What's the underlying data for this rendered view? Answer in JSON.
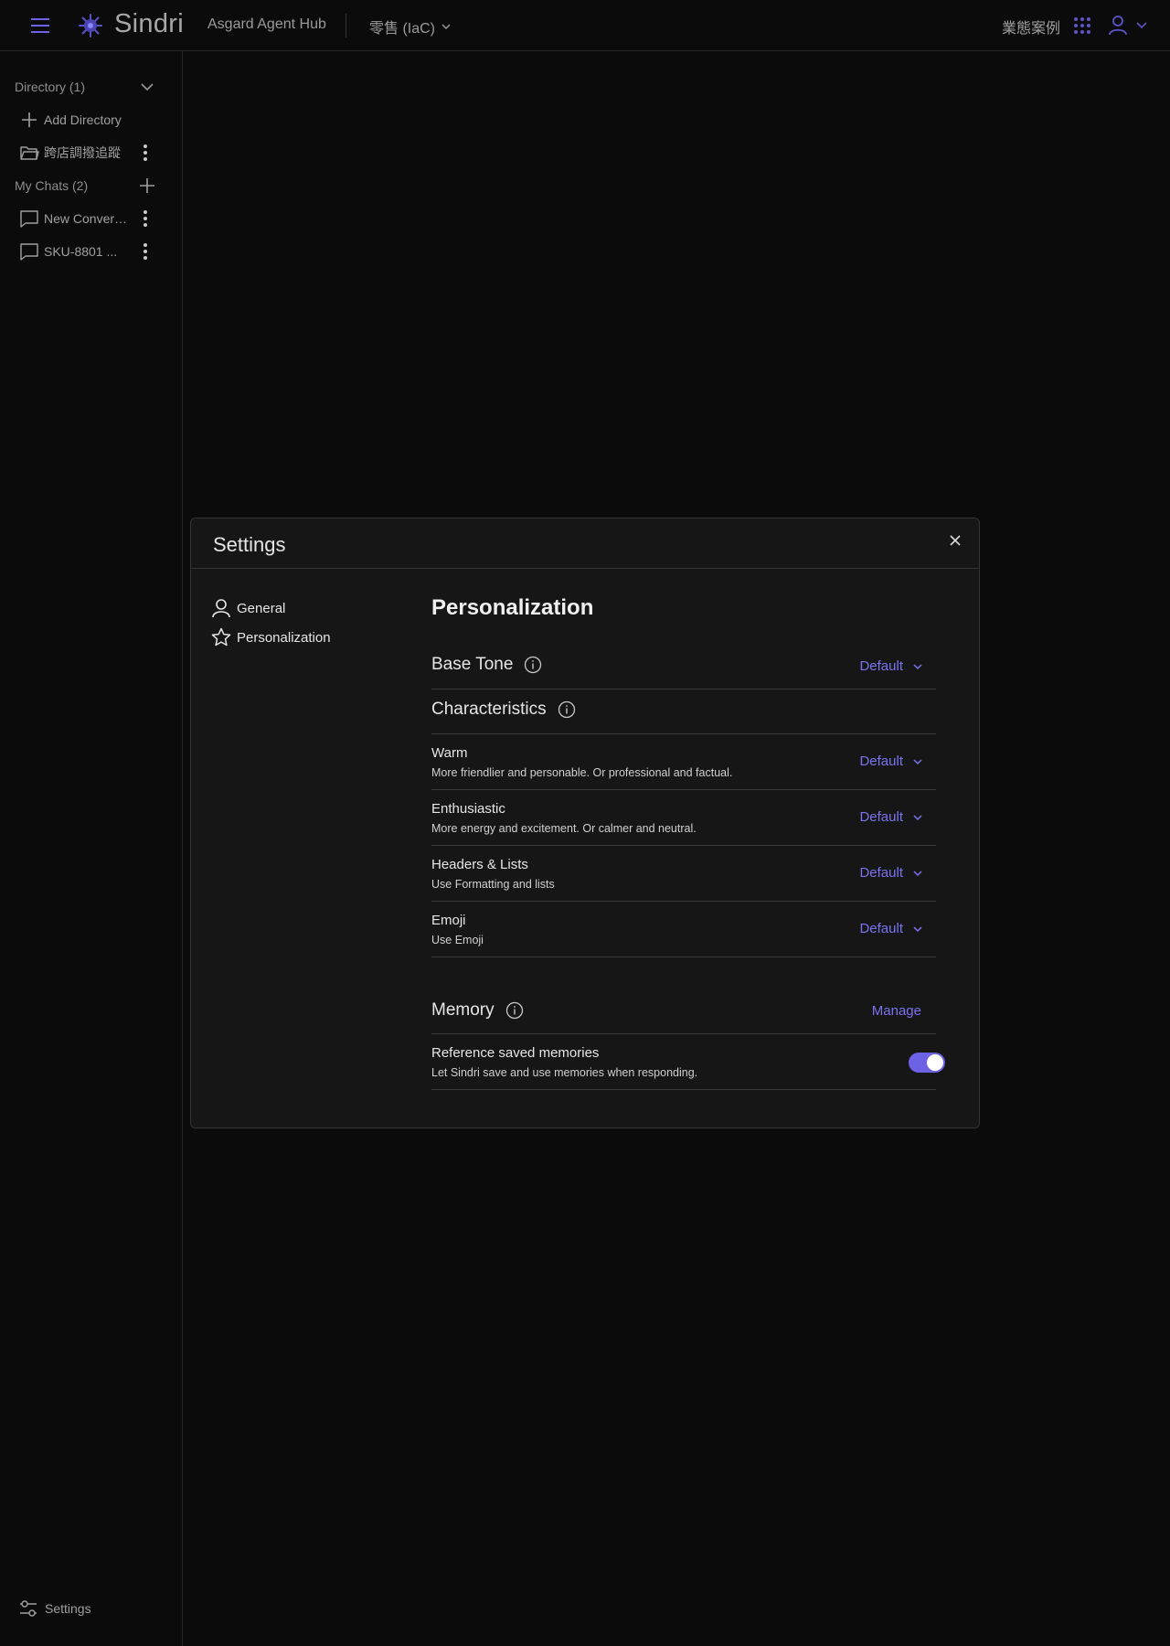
{
  "colors": {
    "accent": "#7b73f0",
    "toggle_on": "#6d62e6",
    "background": "#0b0b0b",
    "modal_bg": "#161616"
  },
  "header": {
    "menu_icon": "hamburger-menu-icon",
    "logo_icon": "sindri-logo-icon",
    "brand": "Sindri",
    "hub_title": "Asgard Agent Hub",
    "workspace": "零售 (IaC)",
    "use_cases": "業態案例",
    "apps_icon": "apps-grid-icon",
    "user_icon": "user-icon"
  },
  "sidebar": {
    "directory": {
      "label": "Directory (1)",
      "add_label": "Add Directory",
      "items": [
        {
          "label": "跨店調撥追蹤",
          "icon": "folder-icon"
        }
      ]
    },
    "chats": {
      "label": "My Chats (2)",
      "items": [
        {
          "label": "New Conversation",
          "icon": "chat-bubble-icon"
        },
        {
          "label": "SKU-8801 ...",
          "icon": "chat-bubble-icon"
        }
      ]
    },
    "settings_label": "Settings"
  },
  "modal": {
    "title": "Settings",
    "nav": [
      {
        "label": "General",
        "icon": "user-icon"
      },
      {
        "label": "Personalization",
        "icon": "star-icon"
      }
    ],
    "panel_title": "Personalization",
    "base_tone": {
      "label": "Base Tone",
      "value": "Default"
    },
    "characteristics": {
      "label": "Characteristics",
      "items": [
        {
          "title": "Warm",
          "description": "More friendlier and personable. Or professional and factual.",
          "value": "Default"
        },
        {
          "title": "Enthusiastic",
          "description": "More energy and excitement. Or calmer and neutral.",
          "value": "Default"
        },
        {
          "title": "Headers & Lists",
          "description": "Use Formatting and lists",
          "value": "Default"
        },
        {
          "title": "Emoji",
          "description": "Use Emoji",
          "value": "Default"
        }
      ]
    },
    "memory": {
      "label": "Memory",
      "manage_label": "Manage",
      "reference": {
        "title": "Reference saved memories",
        "description": "Let Sindri save and use memories when responding.",
        "enabled": true
      }
    }
  }
}
